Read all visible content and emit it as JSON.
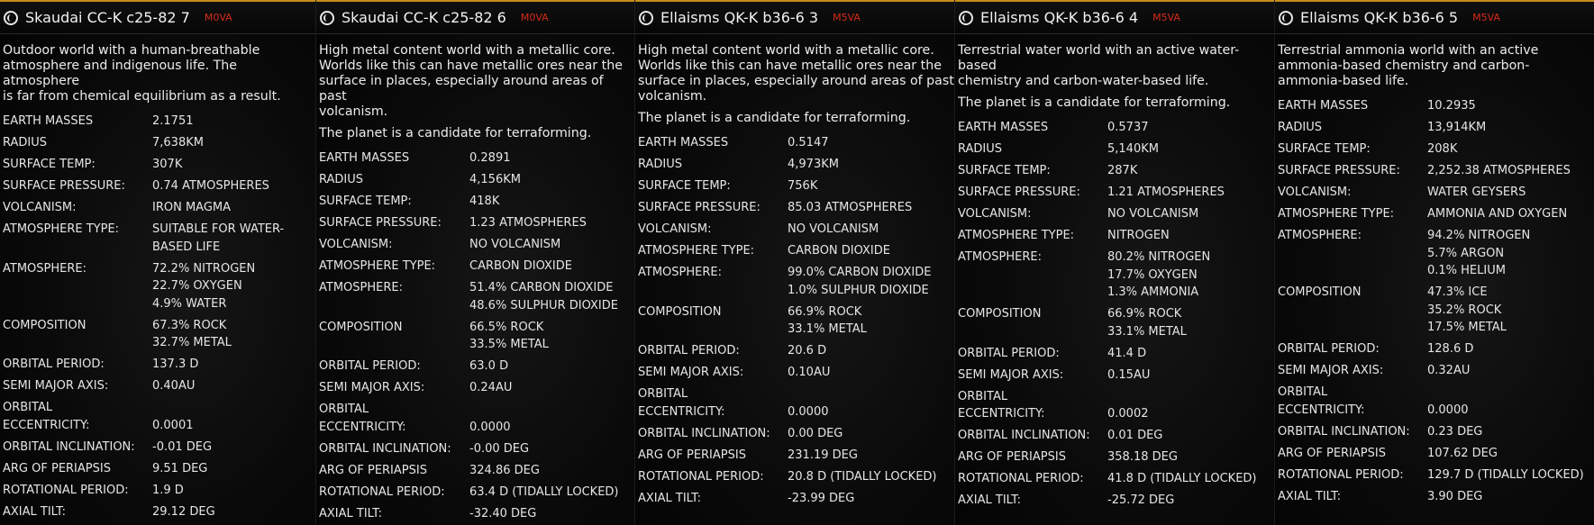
{
  "panels": [
    {
      "name": "Skaudai CC-K c25-82 7",
      "star_class": "M0VA",
      "description": [
        "Outdoor world with a human-breathable\natmosphere and indigenous life. The atmosphere\nis far from chemical equilibrium as a result."
      ],
      "rows": [
        {
          "label": "EARTH MASSES",
          "value": "2.1751"
        },
        {
          "label": "RADIUS",
          "value": "7,638KM"
        },
        {
          "label": "SURFACE TEMP:",
          "value": "307K"
        },
        {
          "label": "SURFACE PRESSURE:",
          "value": "0.74 ATMOSPHERES"
        },
        {
          "label": "VOLCANISM:",
          "value": "IRON MAGMA"
        },
        {
          "label": "ATMOSPHERE TYPE:",
          "value": "SUITABLE FOR WATER-\nBASED LIFE"
        },
        {
          "label": "ATMOSPHERE:",
          "value": "72.2% NITROGEN\n22.7% OXYGEN\n4.9% WATER"
        },
        {
          "label": "COMPOSITION",
          "value": "67.3% ROCK\n32.7% METAL"
        },
        {
          "label": "ORBITAL PERIOD:",
          "value": "137.3 D"
        },
        {
          "label": "SEMI MAJOR AXIS:",
          "value": "0.40AU"
        },
        {
          "label": "ORBITAL\nECCENTRICITY:",
          "value": "\n0.0001"
        },
        {
          "label": "ORBITAL INCLINATION:",
          "value": "-0.01 DEG"
        },
        {
          "label": "ARG OF PERIAPSIS",
          "value": "9.51 DEG"
        },
        {
          "label": "ROTATIONAL PERIOD:",
          "value": "1.9 D"
        },
        {
          "label": "AXIAL TILT:",
          "value": "29.12 DEG"
        }
      ]
    },
    {
      "name": "Skaudai CC-K c25-82 6",
      "star_class": "M0VA",
      "description": [
        "High metal content world with a metallic core.\nWorlds like this can have metallic ores near the\nsurface in places, especially around areas of past\nvolcanism.",
        "The planet is a candidate for terraforming."
      ],
      "rows": [
        {
          "label": "EARTH MASSES",
          "value": "0.2891"
        },
        {
          "label": "RADIUS",
          "value": "4,156KM"
        },
        {
          "label": "SURFACE TEMP:",
          "value": "418K"
        },
        {
          "label": "SURFACE PRESSURE:",
          "value": "1.23 ATMOSPHERES"
        },
        {
          "label": "VOLCANISM:",
          "value": "NO VOLCANISM"
        },
        {
          "label": "ATMOSPHERE TYPE:",
          "value": "CARBON DIOXIDE"
        },
        {
          "label": "ATMOSPHERE:",
          "value": "51.4% CARBON DIOXIDE\n48.6% SULPHUR DIOXIDE"
        },
        {
          "label": "COMPOSITION",
          "value": "66.5% ROCK\n33.5% METAL"
        },
        {
          "label": "ORBITAL PERIOD:",
          "value": "63.0 D"
        },
        {
          "label": "SEMI MAJOR AXIS:",
          "value": "0.24AU"
        },
        {
          "label": "ORBITAL\nECCENTRICITY:",
          "value": "\n0.0000"
        },
        {
          "label": "ORBITAL INCLINATION:",
          "value": "-0.00 DEG"
        },
        {
          "label": "ARG OF PERIAPSIS",
          "value": "324.86 DEG"
        },
        {
          "label": "ROTATIONAL PERIOD:",
          "value": "63.4 D (TIDALLY LOCKED)"
        },
        {
          "label": "AXIAL TILT:",
          "value": "-32.40 DEG"
        }
      ]
    },
    {
      "name": "Ellaisms QK-K b36-6 3",
      "star_class": "M5VA",
      "description": [
        "High metal content world with a metallic core.\nWorlds like this can have metallic ores near the\nsurface in places, especially around areas of past\nvolcanism.",
        "The planet is a candidate for terraforming."
      ],
      "rows": [
        {
          "label": "EARTH MASSES",
          "value": "0.5147"
        },
        {
          "label": "RADIUS",
          "value": "4,973KM"
        },
        {
          "label": "SURFACE TEMP:",
          "value": "756K"
        },
        {
          "label": "SURFACE PRESSURE:",
          "value": "85.03 ATMOSPHERES"
        },
        {
          "label": "VOLCANISM:",
          "value": "NO VOLCANISM"
        },
        {
          "label": "ATMOSPHERE TYPE:",
          "value": "CARBON DIOXIDE"
        },
        {
          "label": "ATMOSPHERE:",
          "value": "99.0% CARBON DIOXIDE\n1.0% SULPHUR DIOXIDE"
        },
        {
          "label": "COMPOSITION",
          "value": "66.9% ROCK\n33.1% METAL"
        },
        {
          "label": "ORBITAL PERIOD:",
          "value": "20.6 D"
        },
        {
          "label": "SEMI MAJOR AXIS:",
          "value": "0.10AU"
        },
        {
          "label": "ORBITAL\nECCENTRICITY:",
          "value": "\n0.0000"
        },
        {
          "label": "ORBITAL INCLINATION:",
          "value": "0.00 DEG"
        },
        {
          "label": "ARG OF PERIAPSIS",
          "value": "231.19 DEG"
        },
        {
          "label": "ROTATIONAL PERIOD:",
          "value": "20.8 D (TIDALLY LOCKED)"
        },
        {
          "label": "AXIAL TILT:",
          "value": "-23.99 DEG"
        }
      ]
    },
    {
      "name": "Ellaisms QK-K b36-6 4",
      "star_class": "M5VA",
      "description": [
        "Terrestrial water world with an active water-based\nchemistry and carbon-water-based life.",
        "The planet is a candidate for terraforming."
      ],
      "rows": [
        {
          "label": "EARTH MASSES",
          "value": "0.5737"
        },
        {
          "label": "RADIUS",
          "value": "5,140KM"
        },
        {
          "label": "SURFACE TEMP:",
          "value": "287K"
        },
        {
          "label": "SURFACE PRESSURE:",
          "value": "1.21 ATMOSPHERES"
        },
        {
          "label": "VOLCANISM:",
          "value": "NO VOLCANISM"
        },
        {
          "label": "ATMOSPHERE TYPE:",
          "value": "NITROGEN"
        },
        {
          "label": "ATMOSPHERE:",
          "value": "80.2% NITROGEN\n17.7% OXYGEN\n1.3% AMMONIA"
        },
        {
          "label": "COMPOSITION",
          "value": "66.9% ROCK\n33.1% METAL"
        },
        {
          "label": "ORBITAL PERIOD:",
          "value": "41.4 D"
        },
        {
          "label": "SEMI MAJOR AXIS:",
          "value": "0.15AU"
        },
        {
          "label": "ORBITAL\nECCENTRICITY:",
          "value": "\n0.0002"
        },
        {
          "label": "ORBITAL INCLINATION:",
          "value": "0.01 DEG"
        },
        {
          "label": "ARG OF PERIAPSIS",
          "value": "358.18 DEG"
        },
        {
          "label": "ROTATIONAL PERIOD:",
          "value": "41.8 D (TIDALLY LOCKED)"
        },
        {
          "label": "AXIAL TILT:",
          "value": "-25.72 DEG"
        }
      ]
    },
    {
      "name": "Ellaisms QK-K b36-6 5",
      "star_class": "M5VA",
      "description": [
        "Terrestrial ammonia world with an active\nammonia-based chemistry and carbon-\nammonia-based life."
      ],
      "rows": [
        {
          "label": "EARTH MASSES",
          "value": "10.2935"
        },
        {
          "label": "RADIUS",
          "value": "13,914KM"
        },
        {
          "label": "SURFACE TEMP:",
          "value": "208K"
        },
        {
          "label": "SURFACE PRESSURE:",
          "value": "2,252.38 ATMOSPHERES"
        },
        {
          "label": "VOLCANISM:",
          "value": "WATER GEYSERS"
        },
        {
          "label": "ATMOSPHERE TYPE:",
          "value": "AMMONIA AND OXYGEN"
        },
        {
          "label": "ATMOSPHERE:",
          "value": "94.2% NITROGEN\n5.7% ARGON\n0.1% HELIUM"
        },
        {
          "label": "COMPOSITION",
          "value": "47.3% ICE\n35.2% ROCK\n17.5% METAL"
        },
        {
          "label": "ORBITAL PERIOD:",
          "value": "128.6 D"
        },
        {
          "label": "SEMI MAJOR AXIS:",
          "value": "0.32AU"
        },
        {
          "label": "ORBITAL\nECCENTRICITY:",
          "value": "\n0.0000"
        },
        {
          "label": "ORBITAL INCLINATION:",
          "value": "0.23 DEG"
        },
        {
          "label": "ARG OF PERIAPSIS",
          "value": "107.62 DEG"
        },
        {
          "label": "ROTATIONAL PERIOD:",
          "value": "129.7 D (TIDALLY LOCKED)"
        },
        {
          "label": "AXIAL TILT:",
          "value": "3.90 DEG"
        }
      ]
    }
  ]
}
